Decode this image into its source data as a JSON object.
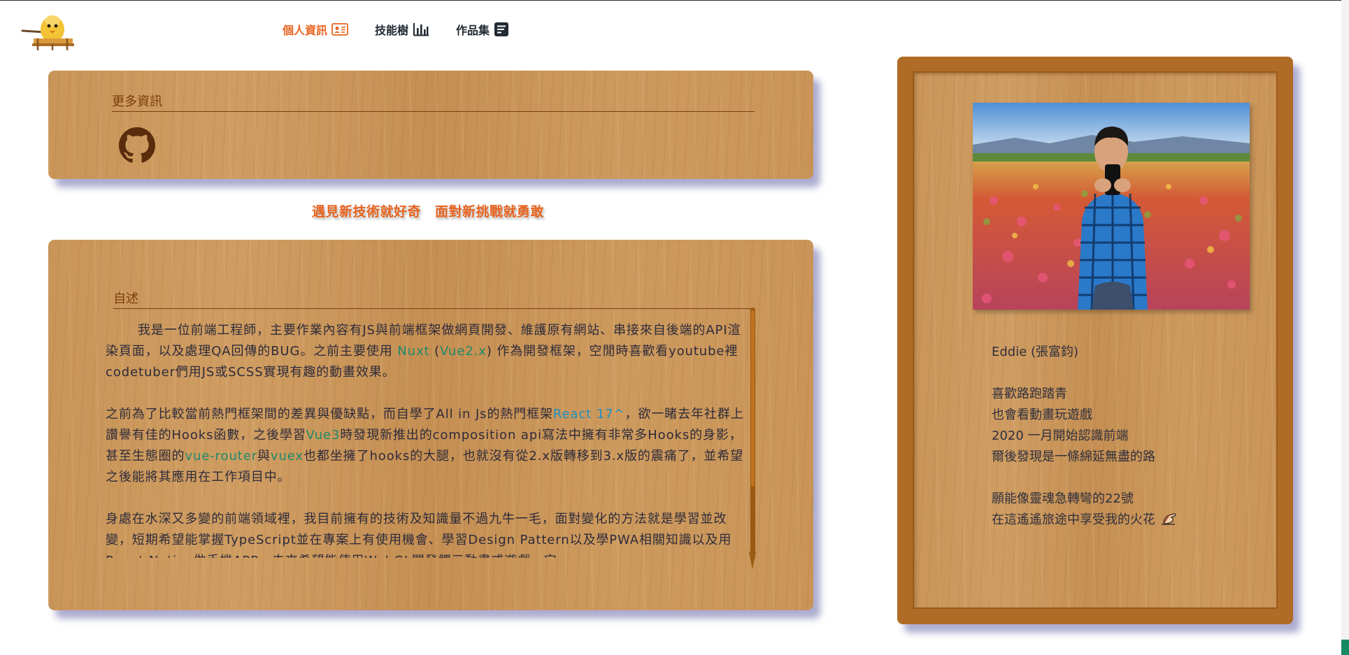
{
  "nav": {
    "items": [
      {
        "label": "個人資訊",
        "icon": "id-card-icon",
        "active": true
      },
      {
        "label": "技能樹",
        "icon": "bar-chart-icon",
        "active": false
      },
      {
        "label": "作品集",
        "icon": "document-icon",
        "active": false
      }
    ]
  },
  "more_info": {
    "title": "更多資訊",
    "links": [
      {
        "icon": "github-icon"
      }
    ]
  },
  "slogan": {
    "part1": "遇見新技術就好奇",
    "part2": "面對新挑戰就勇敢"
  },
  "about": {
    "title": "自述",
    "p1": {
      "t1": "我是一位前端工程師，主要作業內容有JS與前端框架做網頁開發、維護原有網站、串接來自後端的API渲染頁面，以及處理QA回傳的BUG。之前主要使用 ",
      "nuxt": "Nuxt",
      "t2": " (",
      "vue2": "Vue2.x",
      "t3": ") 作為開發框架，空閒時喜歡看youtube裡codetuber們用JS或SCSS實現有趣的動畫效果。"
    },
    "p2": {
      "t1": "之前為了比較當前熱門框架間的差異與優缺點，而自學了All in Js的熱門框架",
      "react": "React 17^",
      "t2": "，欲一睹去年社群上讚譽有佳的Hooks函數，之後學習",
      "vue3": "Vue3",
      "t3": "時發現新推出的composition api寫法中擁有非常多Hooks的身影，甚至生態圈的",
      "router": "vue-router",
      "t4": "與",
      "vuex": "vuex",
      "t5": "也都坐擁了hooks的大腿，也就沒有從2.x版轉移到3.x版的震痛了，並希望之後能將其應用在工作項目中。"
    },
    "p3": "身處在水深又多變的前端領域裡，我目前擁有的技術及知識量不過九牛一毛，面對變化的方法就是學習並改變，短期希望能掌握TypeScript並在專案上有使用機會、學習Design Pattern以及學PWA相關知識以及用React Native做手機APP，未來希望能使用WebGL開發觸三動畫或遊戲，完"
  },
  "profile": {
    "name": "Eddie (張富鈞)",
    "lines": [
      "喜歡路跑踏青",
      "也會看動畫玩遊戲",
      "2020 一月開始認識前端",
      "爾後發現是一條綿延無盡的路"
    ],
    "lines2": [
      "願能像靈魂急轉彎的22號",
      "在這遙遙旅途中享受我的火花"
    ],
    "photo_icon": "profile-photo"
  },
  "colors": {
    "accent": "#e8641f",
    "wood": "#c8955a",
    "frame": "#b06c26",
    "highlight": "#1f8a6a",
    "react": "#1e8fc0"
  }
}
